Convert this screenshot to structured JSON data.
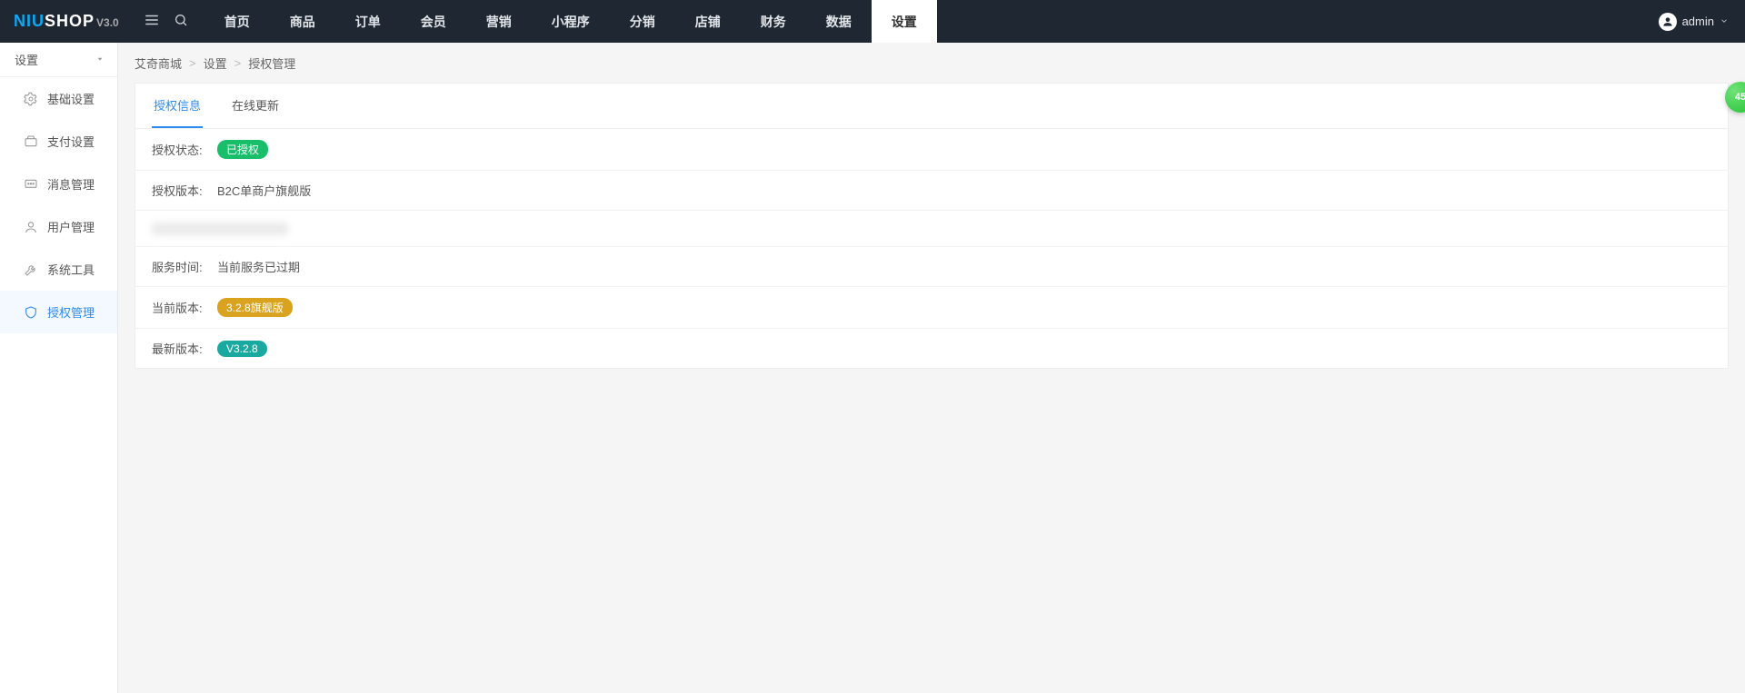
{
  "brand": {
    "part1": "NIU",
    "part2": "SHOP",
    "version": "V3.0"
  },
  "user": {
    "name": "admin"
  },
  "nav": {
    "items": [
      {
        "label": "首页"
      },
      {
        "label": "商品"
      },
      {
        "label": "订单"
      },
      {
        "label": "会员"
      },
      {
        "label": "营销"
      },
      {
        "label": "小程序"
      },
      {
        "label": "分销"
      },
      {
        "label": "店铺"
      },
      {
        "label": "财务"
      },
      {
        "label": "数据"
      },
      {
        "label": "设置",
        "active": true
      }
    ]
  },
  "sidebar": {
    "title": "设置",
    "items": [
      {
        "label": "基础设置",
        "icon": "gear-icon"
      },
      {
        "label": "支付设置",
        "icon": "wallet-icon"
      },
      {
        "label": "消息管理",
        "icon": "message-icon"
      },
      {
        "label": "用户管理",
        "icon": "user-icon"
      },
      {
        "label": "系统工具",
        "icon": "tool-icon"
      },
      {
        "label": "授权管理",
        "icon": "shield-icon",
        "active": true
      }
    ]
  },
  "breadcrumb": {
    "a": "艾奇商城",
    "b": "设置",
    "c": "授权管理",
    "sep": ">"
  },
  "tabs": {
    "a": {
      "label": "授权信息",
      "active": true
    },
    "b": {
      "label": "在线更新"
    }
  },
  "info": {
    "auth_status_label": "授权状态:",
    "auth_status_value": "已授权",
    "auth_version_label": "授权版本:",
    "auth_version_value": "B2C单商户旗舰版",
    "service_time_label": "服务时间:",
    "service_time_value": "当前服务已过期",
    "current_version_label": "当前版本:",
    "current_version_value": "3.2.8旗舰版",
    "latest_version_label": "最新版本:",
    "latest_version_value": "V3.2.8"
  },
  "float_badge": "45"
}
